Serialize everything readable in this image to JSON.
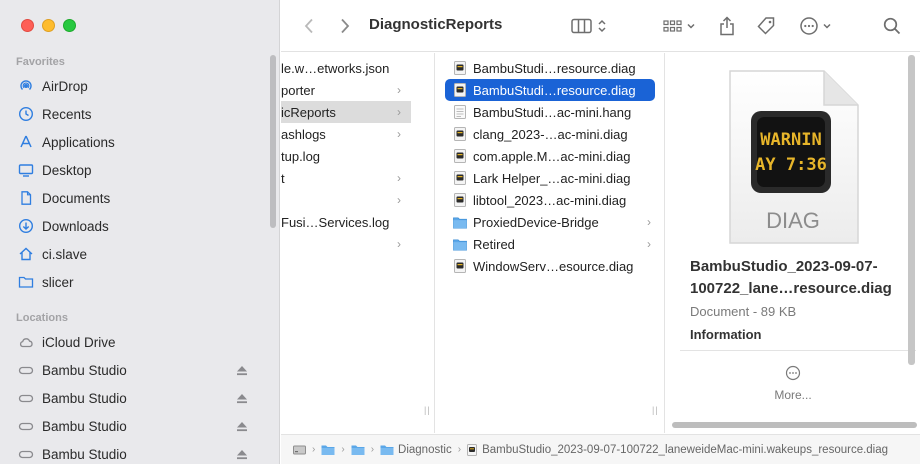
{
  "window": {
    "title": "DiagnosticReports"
  },
  "sidebar": {
    "favorites_header": "Favorites",
    "favorites": [
      {
        "label": "AirDrop",
        "icon": "airdrop-icon"
      },
      {
        "label": "Recents",
        "icon": "clock-icon"
      },
      {
        "label": "Applications",
        "icon": "applications-icon"
      },
      {
        "label": "Desktop",
        "icon": "desktop-icon"
      },
      {
        "label": "Documents",
        "icon": "document-icon"
      },
      {
        "label": "Downloads",
        "icon": "download-icon"
      },
      {
        "label": "ci.slave",
        "icon": "home-icon"
      },
      {
        "label": "slicer",
        "icon": "folder-icon"
      }
    ],
    "locations_header": "Locations",
    "locations": [
      {
        "label": "iCloud Drive",
        "icon": "cloud-icon"
      },
      {
        "label": "Bambu Studio",
        "icon": "disk-icon"
      },
      {
        "label": "Bambu Studio",
        "icon": "disk-icon"
      },
      {
        "label": "Bambu Studio",
        "icon": "disk-icon"
      },
      {
        "label": "Bambu Studio",
        "icon": "disk-icon"
      }
    ]
  },
  "column1": {
    "items": [
      {
        "label": "le.w…etworks.json",
        "chevron": false
      },
      {
        "label": "porter",
        "chevron": true
      },
      {
        "label": "icReports",
        "chevron": true,
        "selected": true
      },
      {
        "label": "ashlogs",
        "chevron": true
      },
      {
        "label": "tup.log",
        "chevron": false
      },
      {
        "label": "t",
        "chevron": true
      },
      {
        "label": "",
        "chevron": true
      },
      {
        "label": "Fusi…Services.log",
        "chevron": false
      },
      {
        "label": "",
        "chevron": true
      }
    ]
  },
  "column2": {
    "items": [
      {
        "label": "BambuStudi…resource.diag",
        "type": "diag"
      },
      {
        "label": "BambuStudi…resource.diag",
        "type": "diag",
        "selected": true
      },
      {
        "label": "BambuStudi…ac-mini.hang",
        "type": "hang"
      },
      {
        "label": "clang_2023-…ac-mini.diag",
        "type": "diag"
      },
      {
        "label": "com.apple.M…ac-mini.diag",
        "type": "diag"
      },
      {
        "label": "Lark Helper_…ac-mini.diag",
        "type": "diag"
      },
      {
        "label": "libtool_2023…ac-mini.diag",
        "type": "diag"
      },
      {
        "label": "ProxiedDevice-Bridge",
        "type": "folder"
      },
      {
        "label": "Retired",
        "type": "folder"
      },
      {
        "label": "WindowServ…esource.diag",
        "type": "diag"
      }
    ]
  },
  "preview": {
    "icon_text_line1": "WARNIN",
    "icon_text_line2": "AY 7:36",
    "icon_ext": "DIAG",
    "name": "BambuStudio_2023-09-07-100722_lane…resource.diag",
    "kind_size": "Document - 89 KB",
    "info_header": "Information",
    "more_label": "More..."
  },
  "pathbar": {
    "segment_diag": "Diagnostic",
    "file": "BambuStudio_2023-09-07-100722_laneweideMac-mini.wakeups_resource.diag"
  },
  "colors": {
    "accent": "#1a63d6",
    "sidebar_bg": "#e9e9ec",
    "folder_blue": "#5aa7e8"
  }
}
